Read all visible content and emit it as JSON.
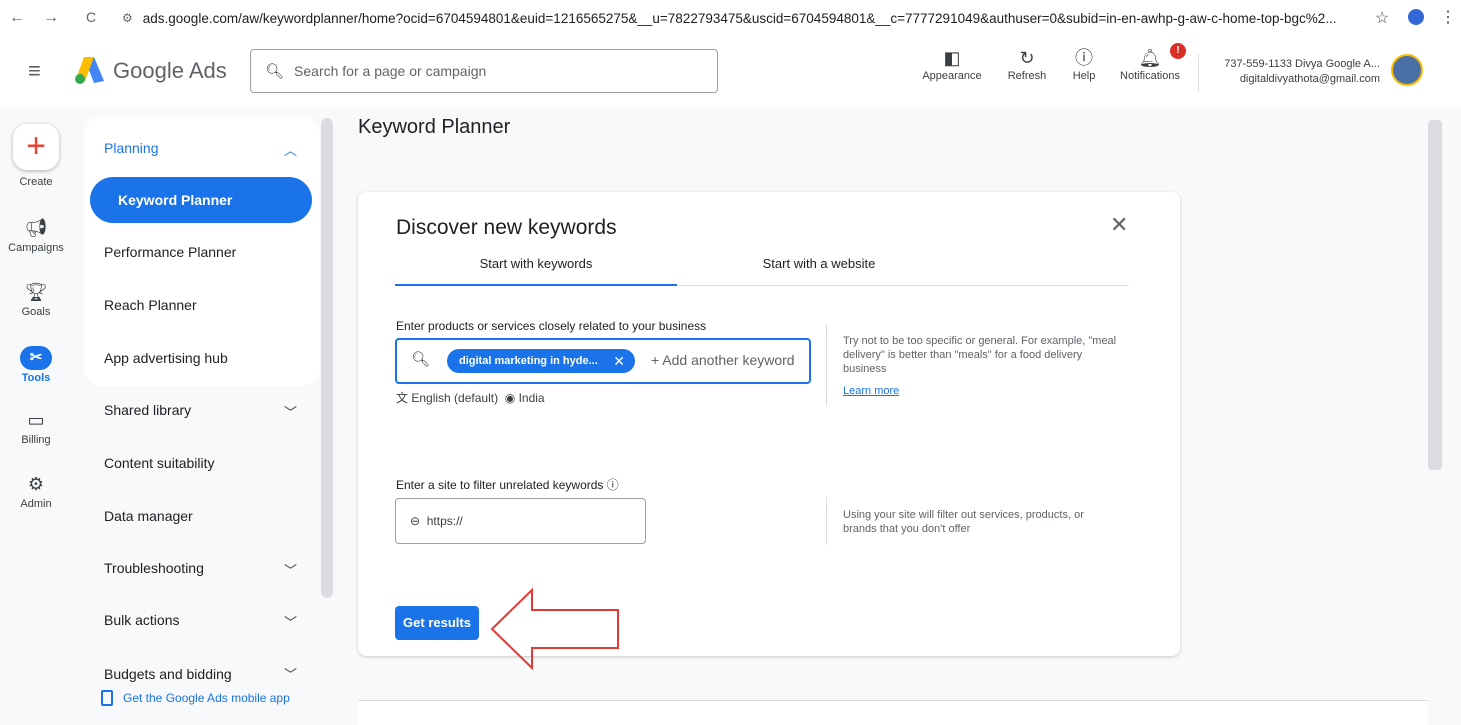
{
  "browser": {
    "back": "←",
    "forward": "→",
    "reload": "C",
    "url": "ads.google.com/aw/keywordplanner/home?ocid=6704594801&euid=1216565275&__u=7822793475&uscid=6704594801&__c=7777291049&authuser=0&subid=in-en-awhp-g-aw-c-home-top-bgc%2...",
    "star": "☆",
    "more": "⋮"
  },
  "header": {
    "brand": "Google Ads",
    "search_placeholder": "Search for a page or campaign",
    "tools": [
      {
        "label": "Appearance",
        "icon": "appearance-icon"
      },
      {
        "label": "Refresh",
        "icon": "refresh-icon"
      },
      {
        "label": "Help",
        "icon": "help-icon"
      },
      {
        "label": "Notifications",
        "icon": "bell-icon",
        "badge": "!"
      }
    ],
    "account_line1": "737-559-1133 Divya Google A...",
    "account_line2": "digitaldivyathota@gmail.com"
  },
  "rail": {
    "items": [
      {
        "label": "Create",
        "icon": "plus-icon"
      },
      {
        "label": "Campaigns",
        "icon": "megaphone-icon"
      },
      {
        "label": "Goals",
        "icon": "trophy-icon"
      },
      {
        "label": "Tools",
        "icon": "tools-icon"
      },
      {
        "label": "Billing",
        "icon": "credit-card-icon"
      },
      {
        "label": "Admin",
        "icon": "gear-icon"
      }
    ]
  },
  "subnav": {
    "planning": "Planning",
    "planning_items": [
      "Keyword Planner",
      "Performance Planner",
      "Reach Planner",
      "App advertising hub"
    ],
    "sections": [
      {
        "label": "Shared library",
        "expandable": true
      },
      {
        "label": "Content suitability",
        "expandable": false
      },
      {
        "label": "Data manager",
        "expandable": false
      },
      {
        "label": "Troubleshooting",
        "expandable": true
      },
      {
        "label": "Bulk actions",
        "expandable": true
      },
      {
        "label": "Budgets and bidding",
        "expandable": true
      }
    ],
    "mobile_app": "Get the Google Ads mobile app"
  },
  "main": {
    "page_title": "Keyword Planner",
    "card": {
      "title": "Discover new keywords",
      "tabs": [
        "Start with keywords",
        "Start with a website"
      ],
      "active_tab": 0,
      "products_label": "Enter products or services closely related to your business",
      "chip": "digital marketing in hyde...",
      "add_placeholder": "+ Add another keyword",
      "language": "English (default)",
      "location": "India",
      "tip": "Try not to be too specific or general. For example, \"meal delivery\" is better than \"meals\" for a food delivery business",
      "learn_more": "Learn more",
      "site_label": "Enter a site to filter unrelated keywords",
      "site_placeholder": "https://",
      "site_tip": "Using your site will filter out services, products, or brands that you don't offer",
      "button": "Get results"
    }
  },
  "colors": {
    "accent": "#1a73e8",
    "arrow": "#e53935"
  }
}
